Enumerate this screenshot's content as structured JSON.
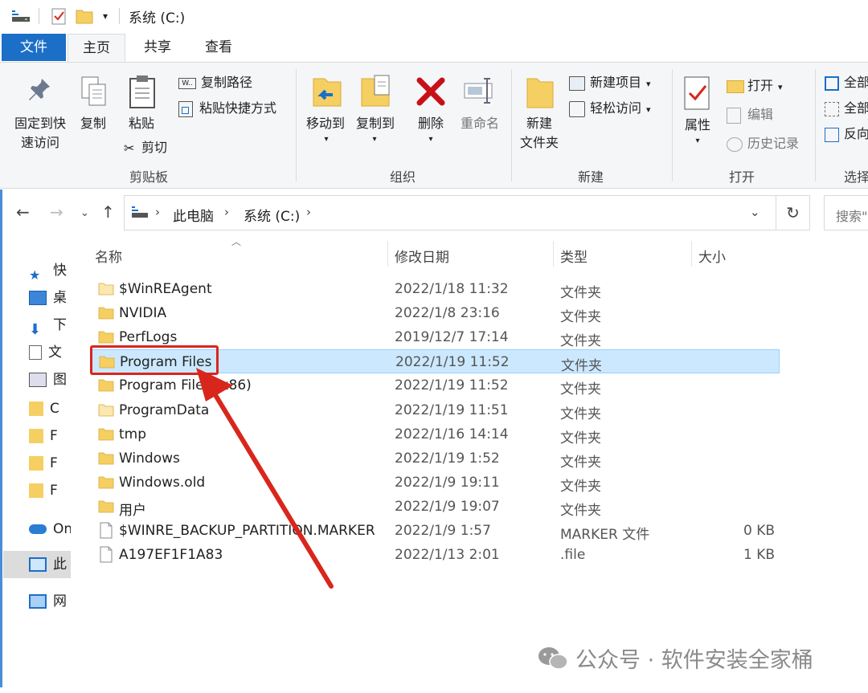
{
  "window": {
    "title": "系统 (C:)",
    "quick_access": [
      "properties-icon",
      "new-folder-icon",
      "customize-dropdown-icon"
    ]
  },
  "ribbon": {
    "tabs": [
      "文件",
      "主页",
      "共享",
      "查看"
    ],
    "active_tab": "主页",
    "clipboard": {
      "pin": "固定到快\n速访问",
      "copy": "复制",
      "paste": "粘贴",
      "copy_path": "复制路径",
      "paste_shortcut": "粘贴快捷方式",
      "cut": "剪切",
      "label": "剪贴板"
    },
    "organize": {
      "move_to": "移动到",
      "copy_to": "复制到",
      "delete": "删除",
      "rename": "重命名",
      "label": "组织"
    },
    "new": {
      "new_folder": "新建\n文件夹",
      "new_item": "新建项目",
      "easy_access": "轻松访问",
      "label": "新建"
    },
    "open": {
      "properties": "属性",
      "open": "打开",
      "edit": "编辑",
      "history": "历史记录",
      "label": "打开"
    },
    "select": {
      "select_all": "全部",
      "select_none": "全部",
      "invert": "反向",
      "label": "选择"
    }
  },
  "address": {
    "segments": [
      "此电脑",
      "系统 (C:)"
    ],
    "search_placeholder": "搜索\""
  },
  "nav_pane": {
    "items": [
      "快",
      "桌",
      "下",
      "文",
      "图",
      "C",
      "F",
      "F",
      "F",
      "On",
      "此",
      "网"
    ]
  },
  "columns": {
    "name": "名称",
    "date": "修改日期",
    "type": "类型",
    "size": "大小"
  },
  "files": [
    {
      "name": "$WinREAgent",
      "date": "2022/1/18 11:32",
      "type": "文件夹",
      "size": "",
      "kind": "folder-light"
    },
    {
      "name": "NVIDIA",
      "date": "2022/1/8 23:16",
      "type": "文件夹",
      "size": "",
      "kind": "folder"
    },
    {
      "name": "PerfLogs",
      "date": "2019/12/7 17:14",
      "type": "文件夹",
      "size": "",
      "kind": "folder"
    },
    {
      "name": "Program Files",
      "date": "2022/1/19 11:52",
      "type": "文件夹",
      "size": "",
      "kind": "folder",
      "selected": true
    },
    {
      "name": "Program Files (x86)",
      "date": "2022/1/19 11:52",
      "type": "文件夹",
      "size": "",
      "kind": "folder"
    },
    {
      "name": "ProgramData",
      "date": "2022/1/19 11:51",
      "type": "文件夹",
      "size": "",
      "kind": "folder-light"
    },
    {
      "name": "tmp",
      "date": "2022/1/16 14:14",
      "type": "文件夹",
      "size": "",
      "kind": "folder"
    },
    {
      "name": "Windows",
      "date": "2022/1/19 1:52",
      "type": "文件夹",
      "size": "",
      "kind": "folder"
    },
    {
      "name": "Windows.old",
      "date": "2022/1/9 19:11",
      "type": "文件夹",
      "size": "",
      "kind": "folder"
    },
    {
      "name": "用户",
      "date": "2022/1/9 19:07",
      "type": "文件夹",
      "size": "",
      "kind": "folder"
    },
    {
      "name": "$WINRE_BACKUP_PARTITION.MARKER",
      "date": "2022/1/9 1:57",
      "type": "MARKER 文件",
      "size": "0 KB",
      "kind": "file"
    },
    {
      "name": "A197EF1F1A83",
      "date": "2022/1/13 2:01",
      "type": ".file",
      "size": "1 KB",
      "kind": "file"
    }
  ],
  "annotation": {
    "color": "#d9261c"
  },
  "watermark": "公众号 · 软件安装全家桶",
  "colors": {
    "accent": "#1b6fc7",
    "selection": "#cce8ff",
    "folder": "#f6cf63"
  }
}
